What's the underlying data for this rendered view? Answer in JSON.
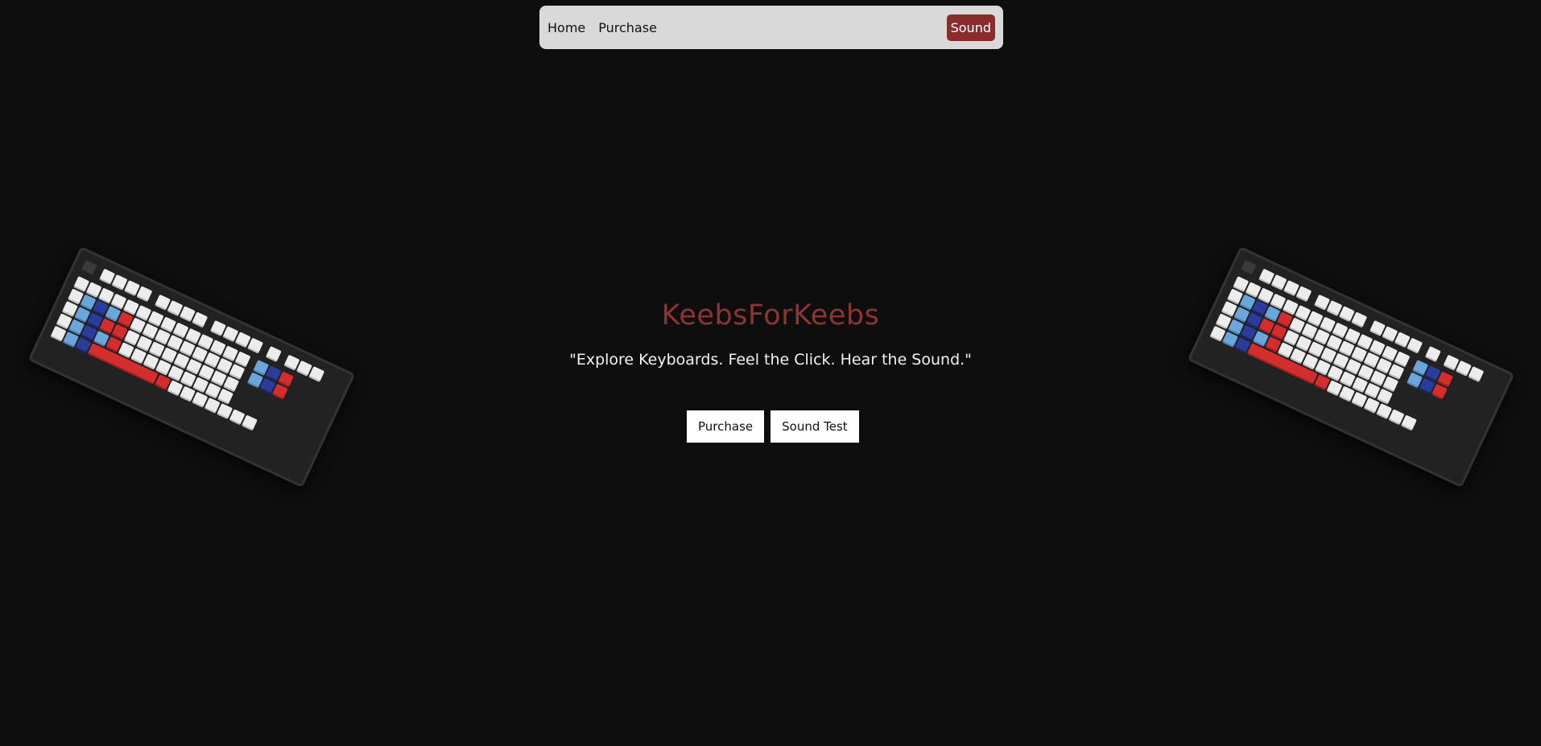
{
  "nav": {
    "home_label": "Home",
    "purchase_label": "Purchase",
    "sound_label": "Sound"
  },
  "hero": {
    "title": "KeebsForKeebs",
    "tagline": "\"Explore Keyboards. Feel the Click. Hear the Sound.\"",
    "purchase_button": "Purchase",
    "sound_test_button": "Sound Test"
  },
  "colors": {
    "background": "#0e0e0e",
    "navbar": "#d9d9d9",
    "accent": "#8b2c2c",
    "title": "#8e3433"
  },
  "images": {
    "keyboard_left": "keyboard-image",
    "keyboard_right": "keyboard-image"
  }
}
